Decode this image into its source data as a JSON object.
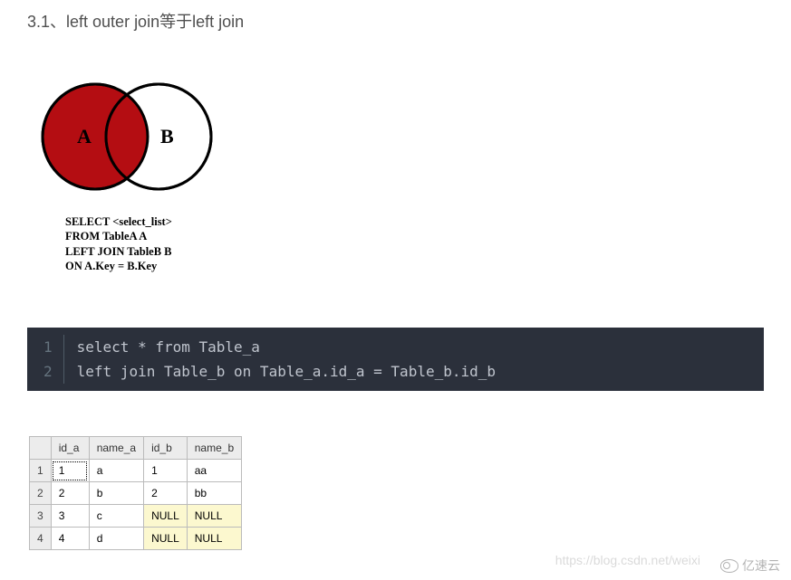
{
  "heading": "3.1、left outer join等于left join",
  "venn": {
    "labelA": "A",
    "labelB": "B",
    "sql_lines": [
      "SELECT <select_list>",
      "FROM TableA A",
      "LEFT JOIN TableB B",
      "ON A.Key = B.Key"
    ]
  },
  "code": {
    "line_numbers": [
      "1",
      "2"
    ],
    "lines": [
      "select * from Table_a",
      "left join Table_b on Table_a.id_a = Table_b.id_b"
    ]
  },
  "result": {
    "headers": [
      "",
      "id_a",
      "name_a",
      "id_b",
      "name_b"
    ],
    "rows": [
      {
        "n": "1",
        "id_a": "1",
        "name_a": "a",
        "id_b": "1",
        "name_b": "aa",
        "nulls": [],
        "selected": "id_a"
      },
      {
        "n": "2",
        "id_a": "2",
        "name_a": "b",
        "id_b": "2",
        "name_b": "bb",
        "nulls": []
      },
      {
        "n": "3",
        "id_a": "3",
        "name_a": "c",
        "id_b": "NULL",
        "name_b": "NULL",
        "nulls": [
          "id_b",
          "name_b"
        ]
      },
      {
        "n": "4",
        "id_a": "4",
        "name_a": "d",
        "id_b": "NULL",
        "name_b": "NULL",
        "nulls": [
          "id_b",
          "name_b"
        ]
      }
    ]
  },
  "watermark": "https://blog.csdn.net/weixi",
  "brand": "亿速云",
  "colors": {
    "venn_fill": "#b40d12",
    "venn_stroke": "#000000",
    "code_bg": "#2b303b",
    "null_bg": "#fcf8cf"
  },
  "chart_data": {
    "type": "table",
    "title": "left outer join result",
    "columns": [
      "id_a",
      "name_a",
      "id_b",
      "name_b"
    ],
    "rows": [
      [
        1,
        "a",
        1,
        "aa"
      ],
      [
        2,
        "b",
        2,
        "bb"
      ],
      [
        3,
        "c",
        null,
        null
      ],
      [
        4,
        "d",
        null,
        null
      ]
    ]
  }
}
